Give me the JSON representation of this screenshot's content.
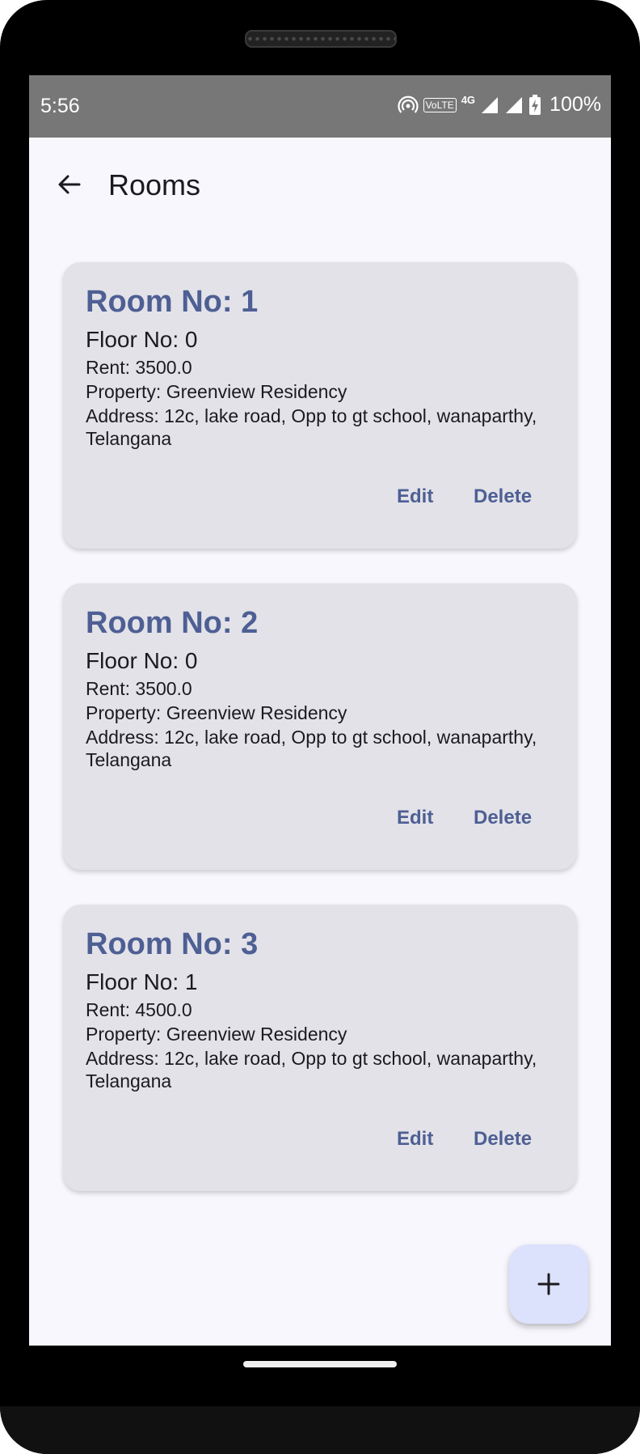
{
  "status_bar": {
    "time": "5:56",
    "battery": "100%",
    "network": "4G",
    "volte": "VoLTE"
  },
  "app_bar": {
    "title": "Rooms"
  },
  "rooms": [
    {
      "title": "Room No: 1",
      "floor": "Floor No: 0",
      "rent": "Rent: 3500.0",
      "property": "Property: Greenview Residency",
      "address": "Address: 12c, lake road, Opp to gt school, wanaparthy, Telangana",
      "edit_label": "Edit",
      "delete_label": "Delete"
    },
    {
      "title": "Room No: 2",
      "floor": "Floor No: 0",
      "rent": "Rent: 3500.0",
      "property": "Property: Greenview Residency",
      "address": "Address: 12c, lake road, Opp to gt school, wanaparthy, Telangana",
      "edit_label": "Edit",
      "delete_label": "Delete"
    },
    {
      "title": "Room No: 3",
      "floor": "Floor No: 1",
      "rent": "Rent: 4500.0",
      "property": "Property: Greenview Residency",
      "address": "Address: 12c, lake road, Opp to gt school, wanaparthy, Telangana",
      "edit_label": "Edit",
      "delete_label": "Delete"
    }
  ],
  "fab": {
    "icon": "plus-icon"
  },
  "colors": {
    "accent": "#4e5f94",
    "card": "#e2e2e8",
    "background": "#f7f7fd",
    "status_bar": "#777777",
    "fab": "#dce2fb"
  }
}
